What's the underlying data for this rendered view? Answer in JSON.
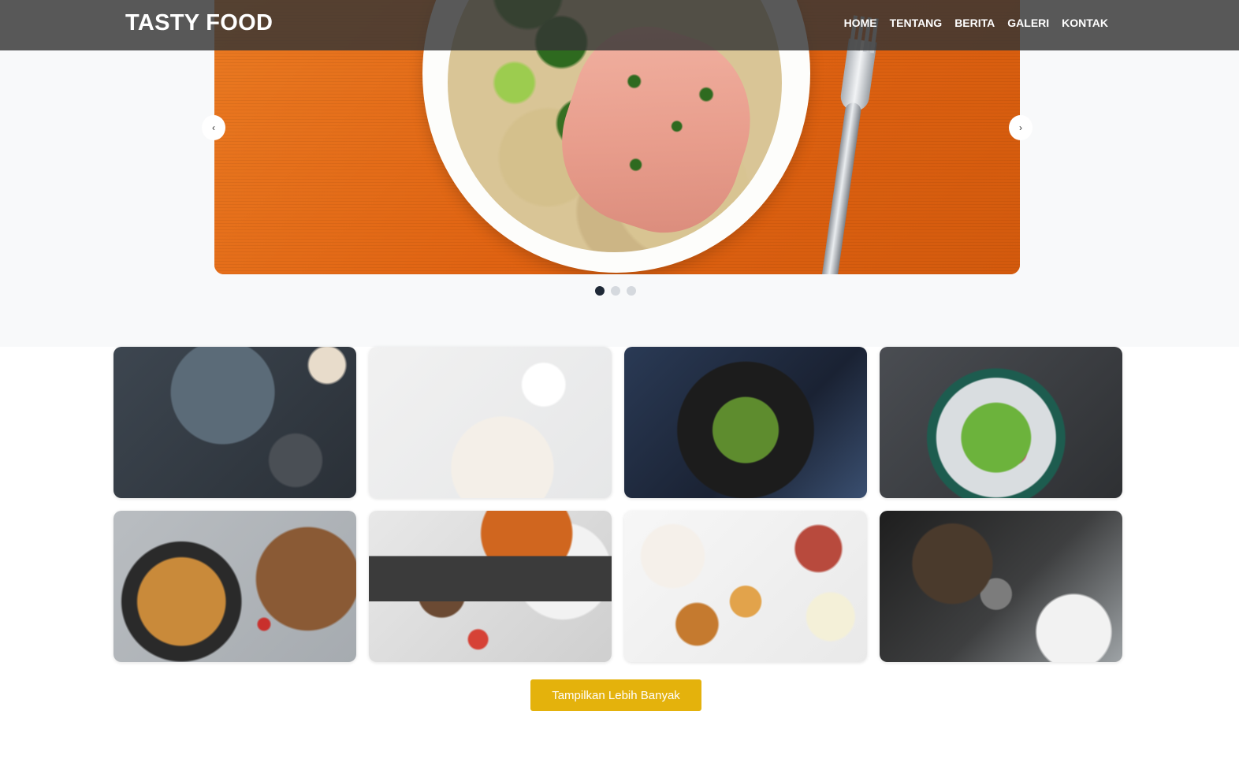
{
  "navbar": {
    "brand": "TASTY FOOD",
    "links": [
      "HOME",
      "TENTANG",
      "BERITA",
      "GALERI",
      "KONTAK"
    ]
  },
  "carousel": {
    "prev_label": "‹",
    "next_label": "›",
    "slide_count": 3,
    "active_slide": 1
  },
  "gallery": {
    "images": [
      "figs-cheese-platter-image",
      "oatmeal-fruit-bowl-image",
      "green-salad-image",
      "flower-salad-bowl-image",
      "curry-pot-image",
      "cooking-kitchen-image",
      "catering-spread-image",
      "chef-plating-image"
    ]
  },
  "more_button": {
    "label": "Tampilkan Lebih Banyak"
  },
  "colors": {
    "navbar_bg": "#343434",
    "accent": "#e4b20c",
    "dot_active": "#1f2937",
    "dot_inactive": "#d5d9de"
  }
}
